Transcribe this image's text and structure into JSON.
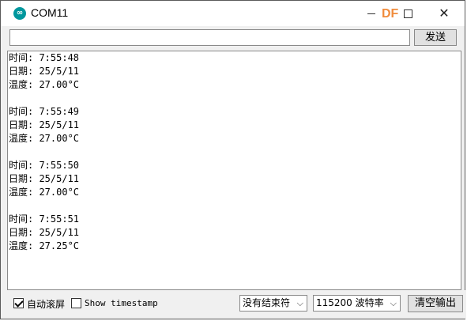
{
  "window": {
    "title": "COM11",
    "watermark": "DF"
  },
  "send": {
    "input_value": "",
    "button_label": "发送"
  },
  "output_lines": [
    "时间: 7:55:48",
    "日期: 25/5/11",
    "温度: 27.00°C",
    "",
    "时间: 7:55:49",
    "日期: 25/5/11",
    "温度: 27.00°C",
    "",
    "时间: 7:55:50",
    "日期: 25/5/11",
    "温度: 27.00°C",
    "",
    "时间: 7:55:51",
    "日期: 25/5/11",
    "温度: 27.25°C"
  ],
  "footer": {
    "autoscroll_label": "自动滚屏",
    "autoscroll_checked": true,
    "timestamp_label": "Show timestamp",
    "timestamp_checked": false,
    "line_ending": "没有结束符",
    "baud_rate": "115200 波特率",
    "clear_label": "清空输出"
  },
  "icons": {
    "app": "arduino-logo-icon",
    "minimize": "minimize-icon",
    "maximize": "maximize-icon",
    "close": "close-icon",
    "chevron": "chevron-down-icon"
  }
}
